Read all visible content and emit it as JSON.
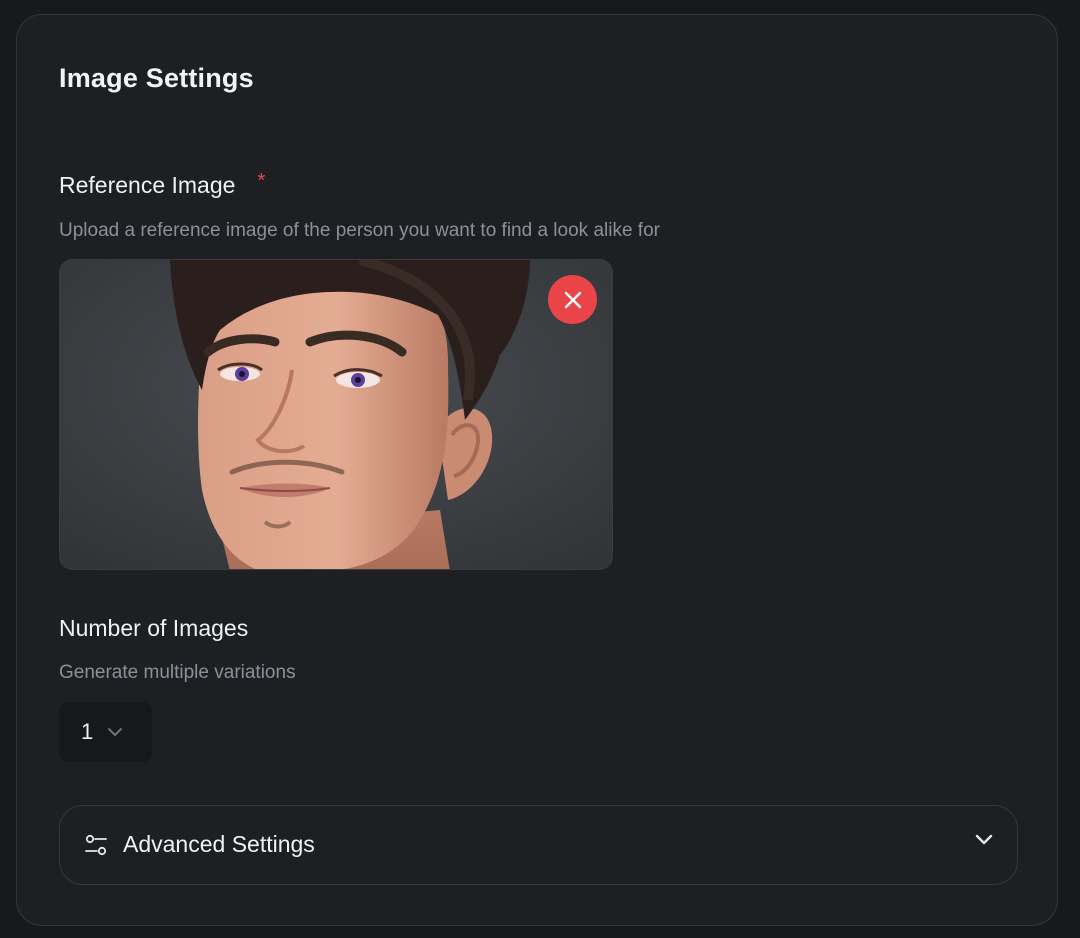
{
  "panel": {
    "title": "Image Settings"
  },
  "reference_image": {
    "label": "Reference Image",
    "required_marker": "*",
    "hint": "Upload a reference image of the person you want to find a look alike for",
    "remove_icon": "close-icon"
  },
  "number_of_images": {
    "label": "Number of Images",
    "hint": "Generate multiple variations",
    "selected_value": "1",
    "chevron_icon": "chevron-down-icon"
  },
  "advanced_settings": {
    "label": "Advanced Settings",
    "icon": "sliders-icon",
    "chevron_icon": "chevron-down-icon"
  },
  "colors": {
    "background": "#18191c",
    "panel": "#1e1f23",
    "required": "#e5484d",
    "remove_button": "#e94448",
    "text_primary": "#f0f1f3",
    "text_muted": "#8c9098"
  }
}
